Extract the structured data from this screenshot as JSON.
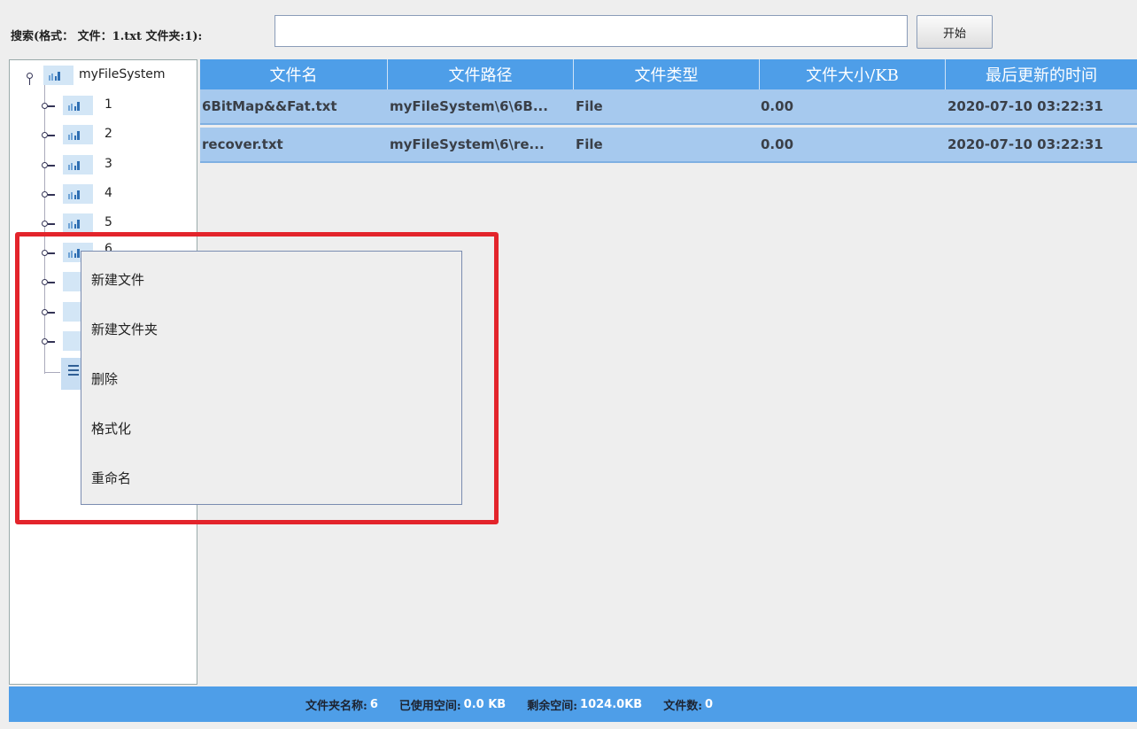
{
  "search": {
    "label": "搜索(格式： 文件：1.txt 文件夹:1):",
    "value": "",
    "button": "开始"
  },
  "tree": {
    "root": "myFileSystem",
    "children": [
      "1",
      "2",
      "3",
      "4",
      "5",
      "6"
    ]
  },
  "table": {
    "columns": [
      "文件名",
      "文件路径",
      "文件类型",
      "文件大小/KB",
      "最后更新的时间"
    ],
    "rows": [
      [
        "6BitMap&&Fat.txt",
        "myFileSystem\\6\\6B...",
        "File",
        "0.00",
        "2020-07-10 03:22:31"
      ],
      [
        "recover.txt",
        "myFileSystem\\6\\re...",
        "File",
        "0.00",
        "2020-07-10 03:22:31"
      ]
    ]
  },
  "context_menu": {
    "items": [
      "新建文件",
      "新建文件夹",
      "删除",
      "格式化",
      "重命名"
    ]
  },
  "status": {
    "folder_name_label": "文件夹名称:",
    "folder_name_value": "6",
    "used_label": "已使用空间:",
    "used_value": "0.0 KB",
    "free_label": "剩余空间:",
    "free_value": "1024.0KB",
    "count_label": "文件数:",
    "count_value": "0"
  },
  "colors": {
    "accent": "#4e9ee8",
    "row_selected": "#a6c9ee",
    "highlight": "#e3242b"
  },
  "icons": {
    "tree_node": "folder-icon",
    "file_node": "file-icon"
  }
}
